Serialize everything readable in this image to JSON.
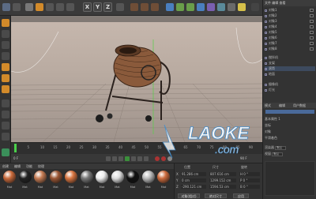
{
  "toolbar": {
    "axes": [
      "X",
      "Y",
      "Z"
    ]
  },
  "object_panel": {
    "tab_title": "文件 编辑 查看",
    "rows": [
      {
        "label": "对象1"
      },
      {
        "label": "对象2"
      },
      {
        "label": "对象3"
      },
      {
        "label": "对象4"
      },
      {
        "label": "对象5"
      },
      {
        "label": "对象6"
      },
      {
        "label": "对象7"
      },
      {
        "label": "对象8"
      },
      {
        "label": "搅拌机"
      },
      {
        "label": "支架"
      },
      {
        "label": "滚筒"
      },
      {
        "label": "地面"
      },
      {
        "label": "摄像机"
      },
      {
        "label": "灯光"
      }
    ],
    "attr_tabs": [
      "模式",
      "编辑",
      "用户数据"
    ],
    "attr_rows": [
      {
        "label": "基本属性",
        "value": "1"
      },
      {
        "label": "坐标",
        "value": ""
      },
      {
        "label": "对象",
        "value": ""
      },
      {
        "label": "平滑着色",
        "value": ""
      },
      {
        "label": "渲染器",
        "value": "默认"
      },
      {
        "label": "视窗",
        "value": "默认"
      }
    ]
  },
  "timeline": {
    "ticks": [
      "0",
      "5",
      "10",
      "15",
      "20",
      "25",
      "30",
      "35",
      "40",
      "45",
      "50",
      "55",
      "60",
      "65",
      "70",
      "75",
      "80",
      "85",
      "90"
    ],
    "current_frame": "0 F",
    "end_frame": "90 F"
  },
  "materials": {
    "menu": [
      "创建",
      "编辑",
      "功能",
      "纹理"
    ],
    "items": [
      {
        "label": "Mat",
        "color": "#c9693a"
      },
      {
        "label": "Mat",
        "color": "#222222"
      },
      {
        "label": "Mat",
        "color": "#c47a52"
      },
      {
        "label": "Mat",
        "color": "#9a5533"
      },
      {
        "label": "Mat",
        "color": "#d8743f"
      },
      {
        "label": "Mat",
        "color": "#777777"
      },
      {
        "label": "Mat",
        "color": "#eeeeee"
      },
      {
        "label": "Mat",
        "color": "#dddddd"
      },
      {
        "label": "Mat",
        "color": "#101010"
      },
      {
        "label": "Mat",
        "color": "#bbbbbb"
      },
      {
        "label": "Mat",
        "color": "#cc6a3c"
      }
    ]
  },
  "coordinates": {
    "headers": [
      "位置",
      "尺寸",
      "旋转"
    ],
    "rows": [
      {
        "axis": "X",
        "pos": "91.286 cm",
        "size": "807.616 cm",
        "rot": "H 0 °"
      },
      {
        "axis": "Y",
        "pos": "0 cm",
        "size": "1299.152 cm",
        "rot": "P 0 °"
      },
      {
        "axis": "Z",
        "pos": "-290.121 cm",
        "size": "1594.53 cm",
        "rot": "B 0 °"
      }
    ],
    "mode_left": "对象(相对)",
    "mode_right": "绝对尺寸",
    "apply": "应用"
  },
  "watermark": {
    "text": "LAOKE",
    "sub": ".com"
  }
}
